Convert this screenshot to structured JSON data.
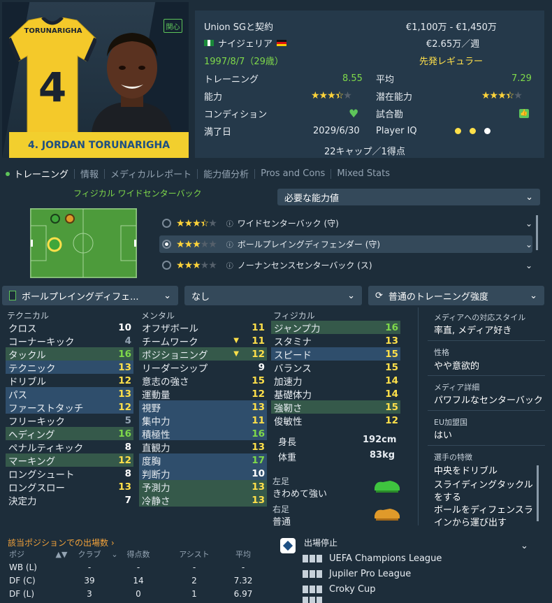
{
  "player": {
    "name": "4. JORDAN TORUNARIGHA",
    "shirt_name": "TORUNARIGHA",
    "shirt_number": "4",
    "interest_badge": "関心"
  },
  "info": {
    "contract_club": "Union SGと契約",
    "value_range": "€1,100万 - €1,450万",
    "nationality": "ナイジェリア",
    "wage": "€2.65万／週",
    "dob": "1997/8/7（29歳）",
    "squad_status": "先発レギュラー",
    "training_label": "トレーニング",
    "training_value": "8.55",
    "avg_label": "平均",
    "avg_value": "7.29",
    "ability_label": "能力",
    "ability_stars": 3.5,
    "potential_label": "潜在能力",
    "potential_stars": 3.5,
    "condition_label": "コンディション",
    "match_fitness_label": "試合勘",
    "expiry_label": "満了日",
    "expiry_value": "2029/6/30",
    "player_iq_label": "Player IQ",
    "caps": "22キャップ／1得点"
  },
  "tabs": [
    "トレーニング",
    "情報",
    "メディカルレポート",
    "能力値分析",
    "Pros and Cons",
    "Mixed Stats"
  ],
  "training": {
    "focus_title": "フィジカル ワイドセンターバック",
    "required_attr_dropdown": "必要な能力値",
    "roles": [
      {
        "stars": 3.5,
        "label": "ワイドセンターバック (守)",
        "selected": false
      },
      {
        "stars": 3,
        "label": "ボールプレイングディフェンダー (守)",
        "selected": true
      },
      {
        "stars": 3,
        "label": "ノーナンセンスセンターバック (ス)",
        "selected": false
      }
    ],
    "role_dropdown": "ボールプレイングディフェ...",
    "extra_dropdown": "なし",
    "intensity_dropdown": "普通のトレーニング強度"
  },
  "attributes": {
    "technical_title": "テクニカル",
    "mental_title": "メンタル",
    "physical_title": "フィジカル",
    "technical": [
      {
        "name": "クロス",
        "value": "10",
        "hl": ""
      },
      {
        "name": "コーナーキック",
        "value": "4",
        "hl": ""
      },
      {
        "name": "タックル",
        "value": "16",
        "hl": "g"
      },
      {
        "name": "テクニック",
        "value": "13",
        "hl": "b"
      },
      {
        "name": "ドリブル",
        "value": "12",
        "hl": ""
      },
      {
        "name": "パス",
        "value": "13",
        "hl": "b"
      },
      {
        "name": "ファーストタッチ",
        "value": "12",
        "hl": "b"
      },
      {
        "name": "フリーキック",
        "value": "5",
        "hl": ""
      },
      {
        "name": "ヘディング",
        "value": "16",
        "hl": "g"
      },
      {
        "name": "ペナルティキック",
        "value": "8",
        "hl": ""
      },
      {
        "name": "マーキング",
        "value": "12",
        "hl": "g"
      },
      {
        "name": "ロングシュート",
        "value": "8",
        "hl": ""
      },
      {
        "name": "ロングスロー",
        "value": "13",
        "hl": ""
      },
      {
        "name": "決定力",
        "value": "7",
        "hl": ""
      }
    ],
    "mental": [
      {
        "name": "オフザボール",
        "value": "11",
        "hl": ""
      },
      {
        "name": "チームワーク",
        "value": "11",
        "hl": ""
      },
      {
        "name": "ポジショニング",
        "value": "12",
        "hl": "g"
      },
      {
        "name": "リーダーシップ",
        "value": "9",
        "hl": ""
      },
      {
        "name": "意志の強さ",
        "value": "15",
        "hl": ""
      },
      {
        "name": "運動量",
        "value": "12",
        "hl": ""
      },
      {
        "name": "視野",
        "value": "13",
        "hl": "b"
      },
      {
        "name": "集中力",
        "value": "11",
        "hl": "b"
      },
      {
        "name": "積極性",
        "value": "16",
        "hl": "b"
      },
      {
        "name": "直観力",
        "value": "13",
        "hl": ""
      },
      {
        "name": "度胸",
        "value": "17",
        "hl": "b"
      },
      {
        "name": "判断力",
        "value": "10",
        "hl": "b"
      },
      {
        "name": "予測力",
        "value": "13",
        "hl": "g"
      },
      {
        "name": "冷静さ",
        "value": "13",
        "hl": "g"
      }
    ],
    "physical": [
      {
        "name": "ジャンプ力",
        "value": "16",
        "hl": "g"
      },
      {
        "name": "スタミナ",
        "value": "13",
        "hl": ""
      },
      {
        "name": "スピード",
        "value": "15",
        "hl": "b"
      },
      {
        "name": "バランス",
        "value": "15",
        "hl": ""
      },
      {
        "name": "加速力",
        "value": "14",
        "hl": ""
      },
      {
        "name": "基礎体力",
        "value": "14",
        "hl": ""
      },
      {
        "name": "強靭さ",
        "value": "15",
        "hl": "g"
      },
      {
        "name": "俊敏性",
        "value": "12",
        "hl": ""
      }
    ],
    "height_label": "身長",
    "height": "192cm",
    "weight_label": "体重",
    "weight": "83kg",
    "left_foot_label": "左足",
    "left_foot": "きわめて強い",
    "right_foot_label": "右足",
    "right_foot": "普通"
  },
  "personality": {
    "media_style_label": "メディアへの対応スタイル",
    "media_style": "率直, メディア好き",
    "personality_label": "性格",
    "personality": "やや意欲的",
    "media_desc_label": "メディア詳細",
    "media_desc": "パワフルなセンターバック",
    "eu_label": "EU加盟国",
    "eu": "はい",
    "traits_label": "選手の特徴",
    "traits": [
      "中央をドリブル",
      "スライディングタックルをする",
      "ボールをディフェンスラインから運び出す"
    ]
  },
  "appearances": {
    "title": "該当ポジションでの出場数",
    "headers": [
      "ポジ",
      "クラブ",
      "得点数",
      "アシスト",
      "平均"
    ],
    "rows": [
      [
        "WB (L)",
        "-",
        "-",
        "-",
        "-"
      ],
      [
        "DF (C)",
        "39",
        "14",
        "2",
        "7.32"
      ],
      [
        "DF (L)",
        "3",
        "0",
        "1",
        "6.97"
      ]
    ]
  },
  "suspension": {
    "title": "出場停止",
    "competitions": [
      "UEFA Champions League",
      "Jupiler Pro League",
      "Croky Cup"
    ]
  },
  "colors": {
    "accent_yellow": "#f2cf2e",
    "green": "#7fd94a",
    "highlight_green": "#35594a",
    "highlight_blue": "#2f4e6c"
  }
}
